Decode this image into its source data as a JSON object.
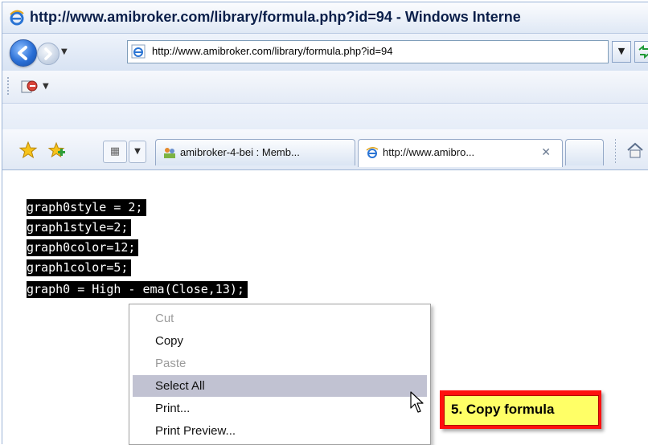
{
  "window": {
    "title": "http://www.amibroker.com/library/formula.php?id=94 - Windows Interne"
  },
  "navigation": {
    "back_icon": "back-arrow-icon",
    "forward_icon": "forward-arrow-icon",
    "address": "http://www.amibroker.com/library/formula.php?id=94",
    "address_dropdown_icon": "chevron-down-icon",
    "refresh_icon": "refresh-icon"
  },
  "command_bar": {
    "icon": "page-tools-icon"
  },
  "tabs": [
    {
      "label": "amibroker-4-bei : Memb...",
      "icon": "group-icon",
      "active": false
    },
    {
      "label": "http://www.amibro...",
      "icon": "ie-page-icon",
      "active": true,
      "close": "✕"
    }
  ],
  "toolbar_icons": {
    "favorites": "star-icon",
    "add_favorites": "add-favorites-icon",
    "quick_tabs": "quick-tabs-icon",
    "home": "home-icon"
  },
  "content": {
    "code_lines": [
      "graph0style = 2;",
      "graph1style=2;",
      "graph0color=12;",
      "graph1color=5;",
      "graph0 = High - ema(Close,13);"
    ]
  },
  "context_menu": {
    "items": [
      {
        "label": "Cut",
        "enabled": false
      },
      {
        "label": "Copy",
        "enabled": true
      },
      {
        "label": "Paste",
        "enabled": false
      },
      {
        "label": "Select All",
        "enabled": true,
        "hover": true
      },
      {
        "label": "Print...",
        "enabled": true
      },
      {
        "label": "Print Preview...",
        "enabled": true
      }
    ]
  },
  "callout": {
    "text": "5. Copy formula",
    "fill": "#ffff66",
    "border": "#ff0f0f"
  }
}
